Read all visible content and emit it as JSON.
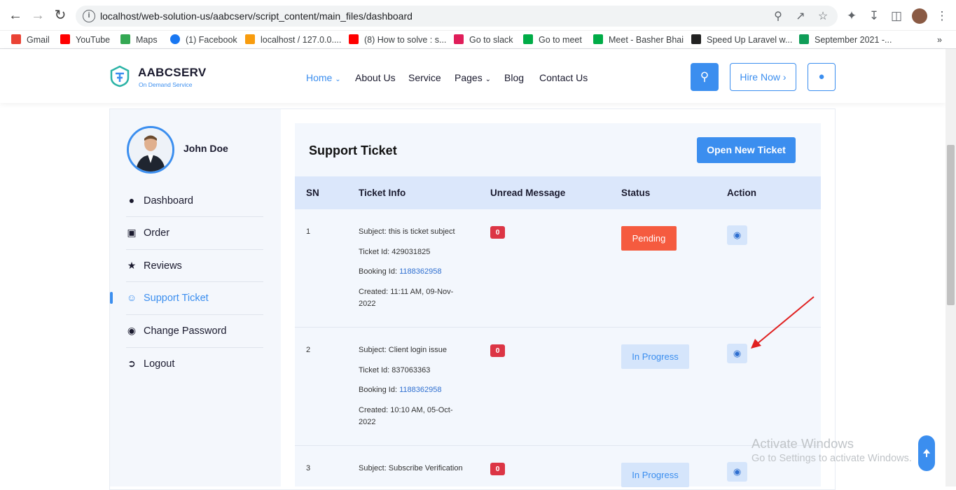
{
  "browser": {
    "url": "localhost/web-solution-us/aabcserv/script_content/main_files/dashboard",
    "bookmarks": [
      {
        "label": "Gmail",
        "color": "#ea4335"
      },
      {
        "label": "YouTube",
        "color": "#ff0000"
      },
      {
        "label": "Maps",
        "color": "#34a853"
      },
      {
        "label": "(1) Facebook",
        "color": "#1877f2"
      },
      {
        "label": "localhost / 127.0.0....",
        "color": "#f89c0e"
      },
      {
        "label": "(8) How to solve : s...",
        "color": "#ff0000"
      },
      {
        "label": "Go to slack",
        "color": "#e01e5a"
      },
      {
        "label": "Go to meet",
        "color": "#00ac47"
      },
      {
        "label": "Meet - Basher Bhai",
        "color": "#00ac47"
      },
      {
        "label": "Speed Up Laravel w...",
        "color": "#222222"
      },
      {
        "label": "September 2021 -...",
        "color": "#0f9d58"
      }
    ],
    "more": "»"
  },
  "header": {
    "logo_title": "AABCSERV",
    "logo_subtitle": "On Demand Service",
    "menu": [
      {
        "label": "Home",
        "has_dropdown": true,
        "active": true
      },
      {
        "label": "About Us"
      },
      {
        "label": "Service"
      },
      {
        "label": "Pages",
        "has_dropdown": true
      },
      {
        "label": "Blog"
      },
      {
        "label": "Contact Us"
      }
    ],
    "hire_label": "Hire Now",
    "accent": "#3b8eef"
  },
  "sidebar": {
    "user_name": "John Doe",
    "items": [
      {
        "label": "Dashboard",
        "icon": "user-icon"
      },
      {
        "label": "Order",
        "icon": "order-icon"
      },
      {
        "label": "Reviews",
        "icon": "star-icon"
      },
      {
        "label": "Support Ticket",
        "icon": "support-icon",
        "active": true
      },
      {
        "label": "Change Password",
        "icon": "user-lock-icon"
      },
      {
        "label": "Logout",
        "icon": "logout-icon"
      }
    ]
  },
  "main": {
    "title": "Support Ticket",
    "open_button": "Open New Ticket",
    "columns": [
      "SN",
      "Ticket Info",
      "Unread Message",
      "Status",
      "Action"
    ],
    "rows": [
      {
        "sn": "1",
        "subject": "Subject: this is ticket subject",
        "ticket_id": "Ticket Id: 429031825",
        "booking_label": "Booking Id: ",
        "booking_id": "1188362958",
        "created_1": "Created: 11:11 AM, 09-Nov-",
        "created_2": "2022",
        "unread": "0",
        "status": "Pending"
      },
      {
        "sn": "2",
        "subject": "Subject: Client login issue",
        "ticket_id": "Ticket Id: 837063363",
        "booking_label": "Booking Id: ",
        "booking_id": "1188362958",
        "created_1": "Created: 10:10 AM, 05-Oct-",
        "created_2": "2022",
        "unread": "0",
        "status": "In Progress"
      },
      {
        "sn": "3",
        "subject": "Subject: Subscribe Verification",
        "unread": "0",
        "status": "In Progress"
      }
    ]
  },
  "watermark": {
    "line1": "Activate Windows",
    "line2": "Go to Settings to activate Windows."
  }
}
